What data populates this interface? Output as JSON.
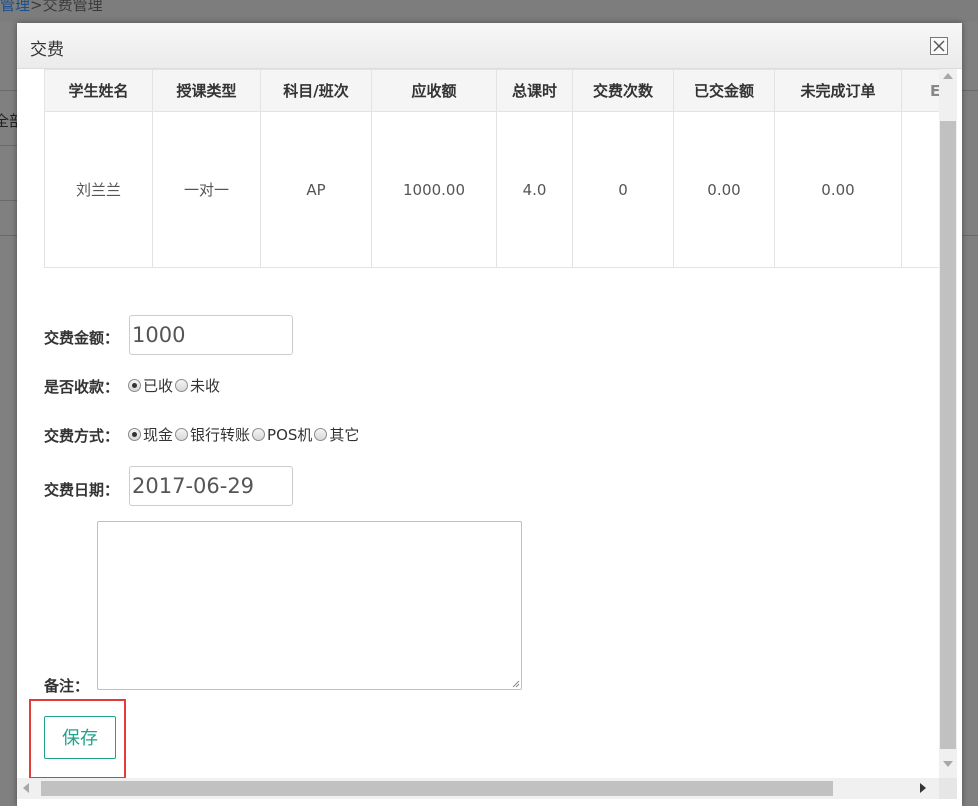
{
  "background": {
    "breadcrumb_link": "管理",
    "breadcrumb_sep": ">",
    "breadcrumb_current": "交费管理",
    "left_text": "全部"
  },
  "dialog": {
    "title": "交费"
  },
  "table": {
    "headers": [
      "学生姓名",
      "授课类型",
      "科目/班次",
      "应收额",
      "总课时",
      "交费次数",
      "已交金额",
      "未完成订单",
      "E"
    ],
    "row": [
      "刘兰兰",
      "一对一",
      "AP",
      "1000.00",
      "4.0",
      "0",
      "0.00",
      "0.00",
      ""
    ]
  },
  "form": {
    "amount_label": "交费金额：",
    "amount_value": "1000",
    "received_label": "是否收款：",
    "received_options": [
      "已收",
      "未收"
    ],
    "received_selected": "已收",
    "method_label": "交费方式：",
    "method_options": [
      "现金",
      "银行转账",
      "POS机",
      "其它"
    ],
    "method_selected": "现金",
    "date_label": "交费日期：",
    "date_value": "2017-06-29",
    "remark_label": "备注：",
    "remark_value": "",
    "save_label": "保存"
  },
  "colors": {
    "save_accent": "#1fa38a",
    "highlight": "#e03c3c"
  }
}
